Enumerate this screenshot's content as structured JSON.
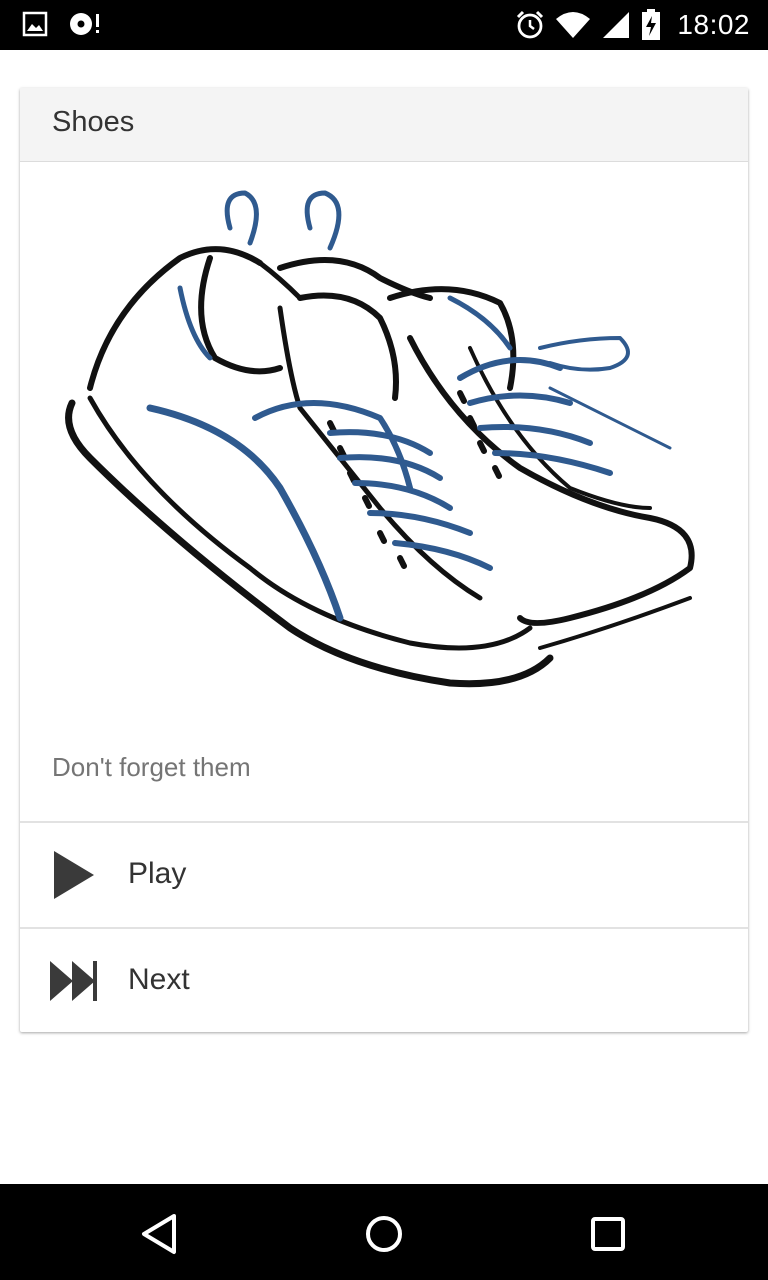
{
  "status_bar": {
    "time": "18:02",
    "left_icons": [
      "image-icon",
      "music-icon"
    ],
    "right_icons": [
      "alarm-icon",
      "wifi-icon",
      "signal-icon",
      "battery-charging-icon"
    ]
  },
  "card": {
    "title": "Shoes",
    "image": {
      "icon": "shoes-illustration"
    },
    "subtitle": "Don't forget them",
    "actions": [
      {
        "label": "Play",
        "icon": "play-icon"
      },
      {
        "label": "Next",
        "icon": "fast-forward-icon"
      }
    ]
  },
  "nav_bar": {
    "buttons": [
      "back-icon",
      "home-icon",
      "recents-icon"
    ]
  },
  "colors": {
    "header_bg": "#f4f4f4",
    "lace_blue": "#2f5a8f",
    "text_dark": "#333333",
    "text_muted": "#757575"
  }
}
